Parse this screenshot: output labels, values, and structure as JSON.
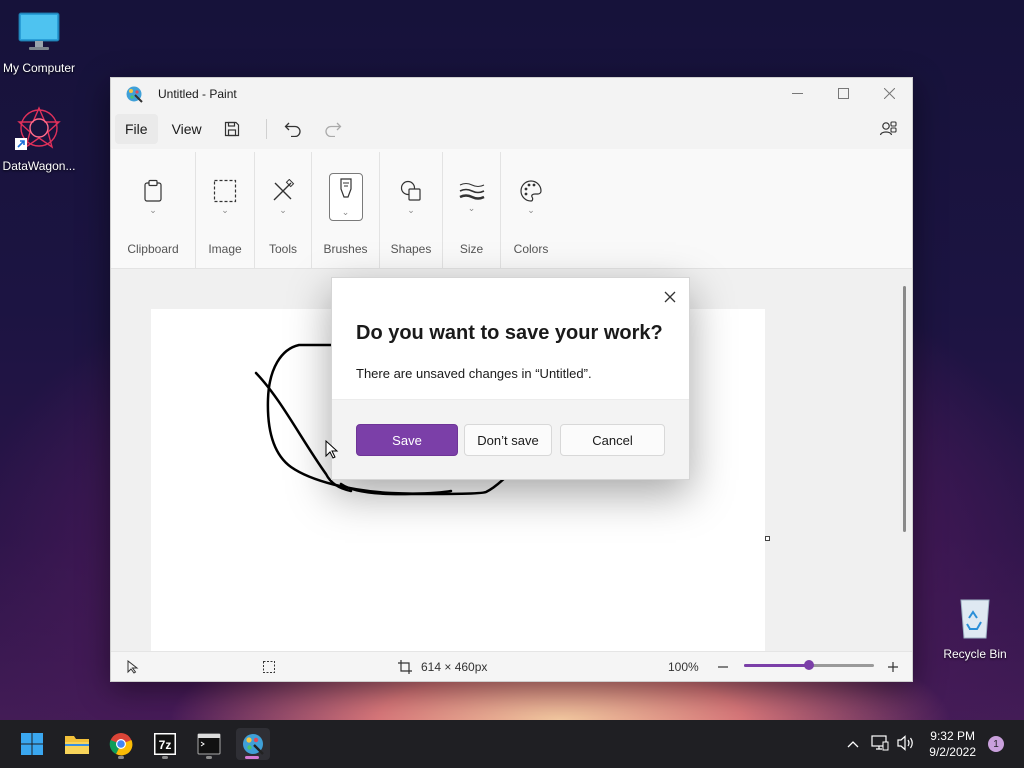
{
  "desktop": {
    "icons": [
      {
        "label": "My Computer"
      },
      {
        "label": "DataWagon..."
      },
      {
        "label": "Recycle Bin"
      }
    ]
  },
  "window": {
    "title": "Untitled - Paint",
    "menu": {
      "file": "File",
      "view": "View"
    },
    "ribbon": {
      "groups": [
        {
          "label": "Clipboard",
          "icon": "clipboard-icon"
        },
        {
          "label": "Image",
          "icon": "selection-icon"
        },
        {
          "label": "Tools",
          "icon": "tools-icon"
        },
        {
          "label": "Brushes",
          "icon": "brush-icon"
        },
        {
          "label": "Shapes",
          "icon": "shapes-icon"
        },
        {
          "label": "Size",
          "icon": "stroke-size-icon"
        },
        {
          "label": "Colors",
          "icon": "palette-icon"
        }
      ]
    },
    "status": {
      "canvas_size": "614 × 460px",
      "zoom": "100%",
      "zoom_level": 0.5
    }
  },
  "dialog": {
    "title": "Do you want to save your work?",
    "message": "There are unsaved changes in “Untitled”.",
    "save": "Save",
    "dont_save": "Don’t save",
    "cancel": "Cancel"
  },
  "taskbar": {
    "time": "9:32 PM",
    "date": "9/2/2022",
    "notifications": "1"
  },
  "colors": {
    "accent": "#7b3fa8",
    "taskbar": "#1f1f23"
  }
}
